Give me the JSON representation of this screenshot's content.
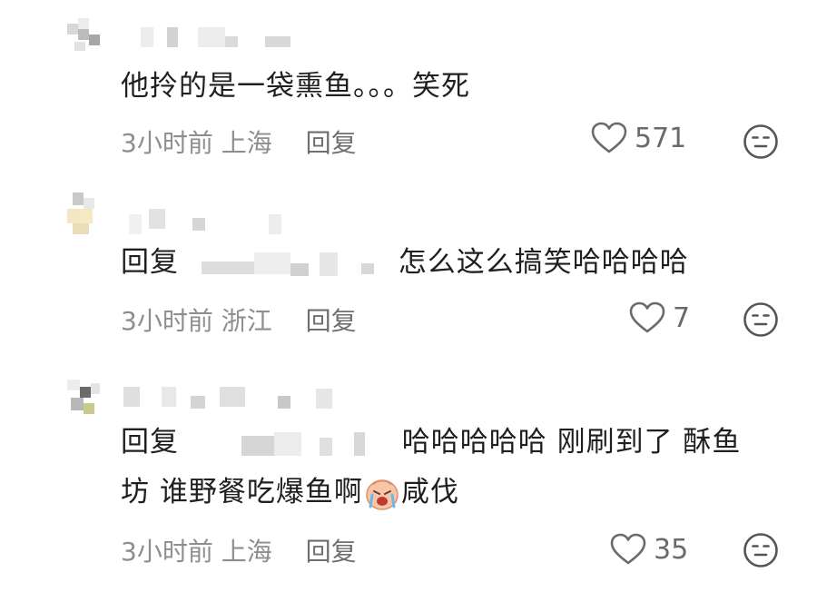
{
  "comments": [
    {
      "text": "他拎的是一袋熏鱼。。。笑死",
      "time": "3小时前",
      "location": "上海",
      "reply_label": "回复",
      "likes": "571"
    },
    {
      "reply_prefix": "回复",
      "text": "怎么这么搞笑哈哈哈哈",
      "time": "3小时前",
      "location": "浙江",
      "reply_label": "回复",
      "likes": "7"
    },
    {
      "reply_prefix": "回复",
      "text_line1": "哈哈哈哈哈 刚刷到了 酥鱼",
      "text_line2_a": "坊 谁野餐吃爆鱼啊",
      "emoji": "crying-face-emoji",
      "text_line2_b": "咸伐",
      "time": "3小时前",
      "location": "上海",
      "reply_label": "回复",
      "likes": "35"
    }
  ],
  "icons": {
    "like": "heart-outline-icon",
    "dislike": "neutral-face-icon"
  },
  "colors": {
    "text": "#1f1f1f",
    "meta": "#8e8e8e",
    "icon": "#6a6a6a"
  }
}
